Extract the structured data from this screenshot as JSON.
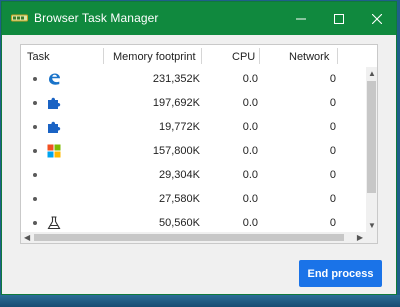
{
  "window": {
    "title": "Browser Task Manager",
    "titlebar_color": "#10893e",
    "controls": [
      "minimize-icon",
      "maximize-icon",
      "close-icon"
    ]
  },
  "table": {
    "columns": [
      "Task",
      "Memory footprint",
      "CPU",
      "Network"
    ],
    "rows": [
      {
        "icon": "edge-icon",
        "memory": "231,352K",
        "cpu": "0.0",
        "network": "0"
      },
      {
        "icon": "extension-puzzle-icon",
        "memory": "197,692K",
        "cpu": "0.0",
        "network": "0"
      },
      {
        "icon": "extension-puzzle-icon",
        "memory": "19,772K",
        "cpu": "0.0",
        "network": "0"
      },
      {
        "icon": "windows-logo-icon",
        "memory": "157,800K",
        "cpu": "0.0",
        "network": "0"
      },
      {
        "icon": "",
        "memory": "29,304K",
        "cpu": "0.0",
        "network": "0"
      },
      {
        "icon": "",
        "memory": "27,580K",
        "cpu": "0.0",
        "network": "0"
      },
      {
        "icon": "lab-flask-icon",
        "memory": "50,560K",
        "cpu": "0.0",
        "network": "0"
      }
    ]
  },
  "actions": {
    "end_process_label": "End process",
    "accent_color": "#1a73e8"
  }
}
